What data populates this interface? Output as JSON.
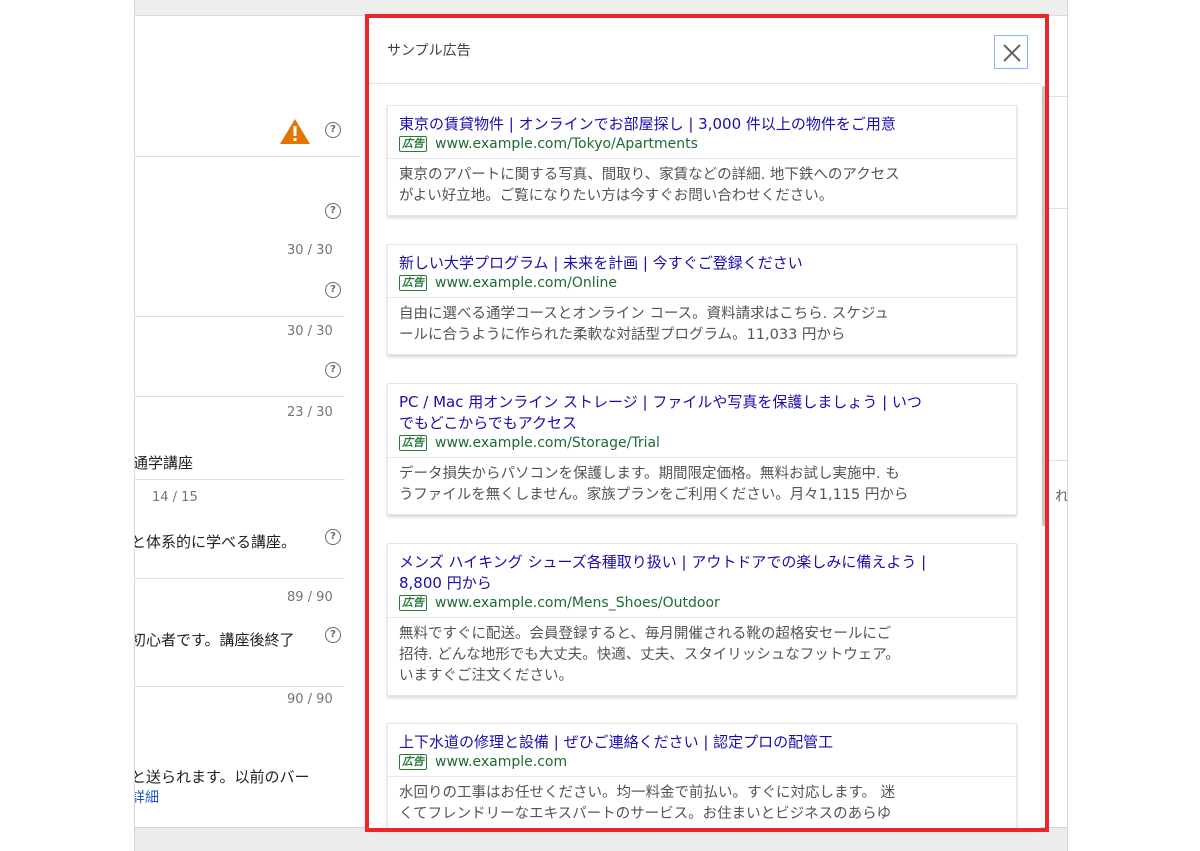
{
  "background_form": {
    "counters": [
      "30 / 30",
      "30 / 30",
      "23 / 30",
      "14 / 15",
      "89 / 90",
      "90 / 90"
    ],
    "texts": {
      "course_name": "通学講座",
      "description_1": "と体系的に学べる講座。",
      "description_2": "初心者です。講座後終了",
      "notice": "と送られます。以前のバー",
      "details_link": "詳細"
    },
    "help_icon_glyph": "?"
  },
  "modal": {
    "title": "サンプル広告",
    "close_label": "✕",
    "ad_badge": "広告",
    "ads": [
      {
        "title": "東京の賃貸物件 | オンラインでお部屋探し | 3,000 件以上の物件をご用意",
        "url": "www.example.com/Tokyo/Apartments",
        "description": "東京のアパートに関する写真、間取り、家賃などの詳細. 地下鉄へのアクセス\nがよい好立地。ご覧になりたい方は今すぐお問い合わせください。"
      },
      {
        "title": "新しい大学プログラム | 未来を計画 | 今すぐご登録ください",
        "url": "www.example.com/Online",
        "description": "自由に選べる通学コースとオンライン コース。資料請求はこちら. スケジュ\nールに合うように作られた柔軟な対話型プログラム。11,033 円から"
      },
      {
        "title": "PC / Mac 用オンライン ストレージ | ファイルや写真を保護しましょう | いつ\nでもどこからでもアクセス",
        "url": "www.example.com/Storage/Trial",
        "description": "データ損失からパソコンを保護します。期間限定価格。無料お試し実施中. も\nうファイルを無くしません。家族プランをご利用ください。月々1,115 円から"
      },
      {
        "title": "メンズ ハイキング シューズ各種取り扱い | アウトドアでの楽しみに備えよう |\n8,800 円から",
        "url": "www.example.com/Mens_Shoes/Outdoor",
        "description": "無料ですぐに配送。会員登録すると、毎月開催される靴の超格安セールにご\n招待. どんな地形でも大丈夫。快適、丈夫、スタイリッシュなフットウェア。\nいますぐご注文ください。"
      },
      {
        "title": "上下水道の修理と設備 | ぜひご連絡ください | 認定プロの配管工",
        "url": "www.example.com",
        "description": "水回りの工事はお任せください。均一料金で前払い。すぐに対応します。 迷\nくてフレンドリーなエキスパートのサービス。お住まいとビジネスのあらゆ"
      }
    ]
  },
  "colors": {
    "highlight": "#e8262c",
    "ad_title": "#1a0dab",
    "ad_url": "#1e6b33",
    "warning": "#e37400"
  },
  "right_edge_glyph": "れ"
}
